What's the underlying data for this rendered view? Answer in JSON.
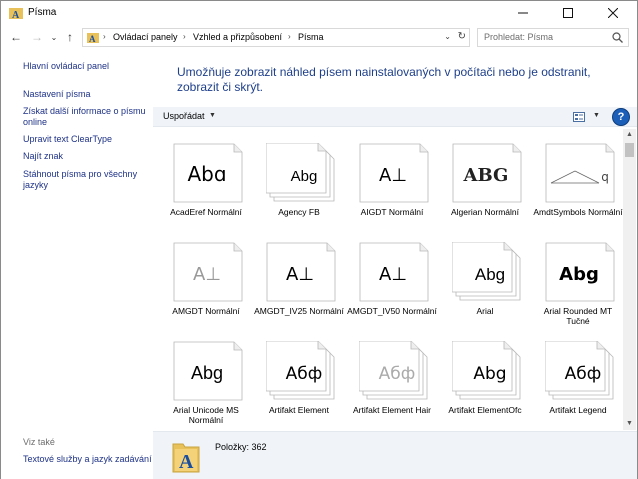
{
  "window": {
    "title": "Písma"
  },
  "nav": {
    "back": "←",
    "forward": "→",
    "recent": "⌄",
    "up": "↑",
    "breadcrumb": [
      "Ovládací panely",
      "Vzhled a přizpůsobení",
      "Písma"
    ],
    "search_placeholder": "Prohledat: Písma"
  },
  "left_pane": {
    "links": [
      "Hlavní ovládací panel",
      "Nastavení písma",
      "Získat další informace o písmu online",
      "Upravit text ClearType",
      "Najít znak",
      "Stáhnout písma pro všechny jazyky"
    ],
    "see_also_label": "Viz také",
    "see_also_links": [
      "Textové služby a jazyk zadávání"
    ]
  },
  "main": {
    "heading": "Umožňuje zobrazit náhled písem nainstalovaných v počítači nebo je odstranit, zobrazit či skrýt."
  },
  "toolbar": {
    "organize_label": "Uspořádat",
    "help_label": "?"
  },
  "fonts": [
    {
      "name": "AcadEref Normální",
      "sample": "Abɑ",
      "stack": false
    },
    {
      "name": "Agency FB",
      "sample": "Abg",
      "stack": true
    },
    {
      "name": "AIGDT Normální",
      "sample": "A⊥",
      "stack": false
    },
    {
      "name": "Algerian Normální",
      "sample": "ABG",
      "stack": false
    },
    {
      "name": "AmdtSymbols Normální",
      "sample": "q",
      "stack": false
    },
    {
      "name": "AMGDT Normální",
      "sample": "A⊥",
      "stack": false
    },
    {
      "name": "AMGDT_IV25 Normální",
      "sample": "A⊥",
      "stack": false
    },
    {
      "name": "AMGDT_IV50 Normální",
      "sample": "A⊥",
      "stack": false
    },
    {
      "name": "Arial",
      "sample": "Abg",
      "stack": true
    },
    {
      "name": "Arial Rounded MT Tučné",
      "sample": "Abg",
      "stack": false
    },
    {
      "name": "Arial Unicode MS Normální",
      "sample": "Abg",
      "stack": false
    },
    {
      "name": "Artifakt Element",
      "sample": "Абф",
      "stack": true
    },
    {
      "name": "Artifakt Element Hair",
      "sample": "Абф",
      "stack": true
    },
    {
      "name": "Artifakt ElementOfc",
      "sample": "Abg",
      "stack": true
    },
    {
      "name": "Artifakt Legend",
      "sample": "Абф",
      "stack": true
    }
  ],
  "details": {
    "items_label": "Položky: 362"
  }
}
